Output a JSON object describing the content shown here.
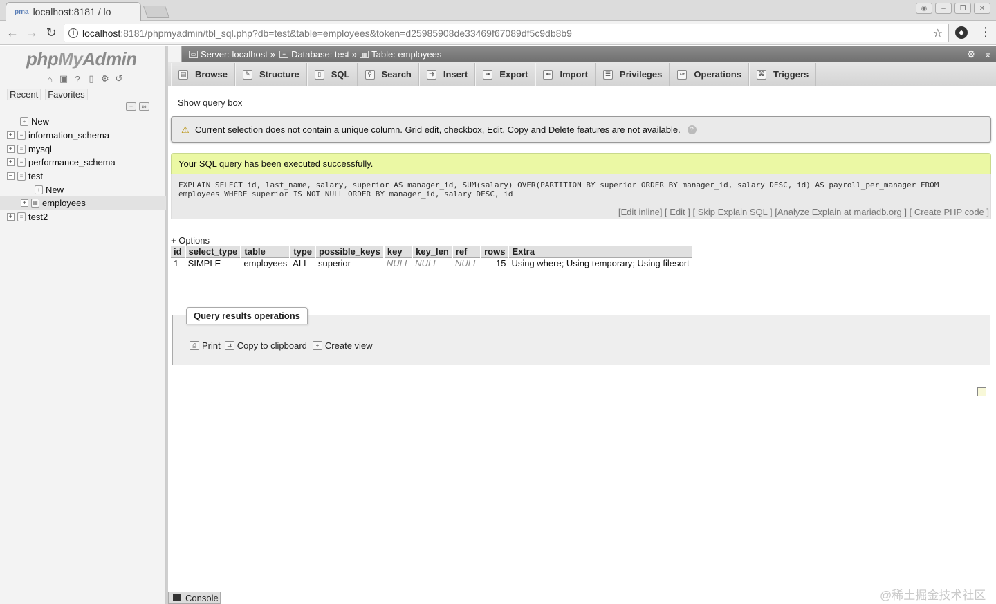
{
  "browser": {
    "tab_title": "localhost:8181 / lo",
    "url_host": "localhost",
    "url_path": ":8181/phpmyadmin/tbl_sql.php?db=test&table=employees&token=d25985908de33469f67089df5c9db8b9"
  },
  "nav": {
    "logo_a": "php",
    "logo_b": "My",
    "logo_c": "Admin",
    "tabs": [
      "Recent",
      "Favorites"
    ],
    "tree": [
      {
        "label": "New",
        "indent": 0,
        "expander": ""
      },
      {
        "label": "information_schema",
        "indent": 0,
        "expander": "+"
      },
      {
        "label": "mysql",
        "indent": 0,
        "expander": "+"
      },
      {
        "label": "performance_schema",
        "indent": 0,
        "expander": "+"
      },
      {
        "label": "test",
        "indent": 0,
        "expander": "−"
      },
      {
        "label": "New",
        "indent": 1,
        "expander": ""
      },
      {
        "label": "employees",
        "indent": 1,
        "expander": "+"
      },
      {
        "label": "test2",
        "indent": 0,
        "expander": "+"
      }
    ]
  },
  "breadcrumb": {
    "server": "Server: localhost",
    "database": "Database: test",
    "table": "Table: employees",
    "sep": "»"
  },
  "menu": [
    "Browse",
    "Structure",
    "SQL",
    "Search",
    "Insert",
    "Export",
    "Import",
    "Privileges",
    "Operations",
    "Triggers"
  ],
  "main": {
    "show_query_box": "Show query box",
    "notice": "Current selection does not contain a unique column. Grid edit, checkbox, Edit, Copy and Delete features are not available.",
    "success": "Your SQL query has been executed successfully.",
    "sql_line1": "EXPLAIN SELECT id, last_name, salary, superior AS manager_id, SUM(salary) OVER(PARTITION BY superior ORDER BY manager_id, salary DESC, id) AS payroll_per_manager FROM",
    "sql_line2": "employees WHERE superior IS NOT NULL ORDER BY manager_id, salary DESC, id",
    "sql_links": "[Edit inline] [  Edit  ] [  Skip Explain SQL ] [Analyze Explain at mariadb.org ] [  Create PHP code  ]",
    "options": "+ Options"
  },
  "explain_table": {
    "headers": [
      "id",
      "select_type",
      "table",
      "type",
      "possible_keys",
      "key",
      "key_len",
      "ref",
      "rows",
      "Extra"
    ],
    "row": [
      "1",
      "SIMPLE",
      "employees",
      "ALL",
      "superior",
      "NULL",
      "NULL",
      "NULL",
      "15",
      "Using where; Using temporary; Using filesort"
    ]
  },
  "query_ops": {
    "legend": "Query results operations",
    "print": "Print",
    "copy": "Copy to clipboard",
    "create_view": "Create view"
  },
  "console_label": "Console",
  "watermark": "@稀土掘金技术社区"
}
